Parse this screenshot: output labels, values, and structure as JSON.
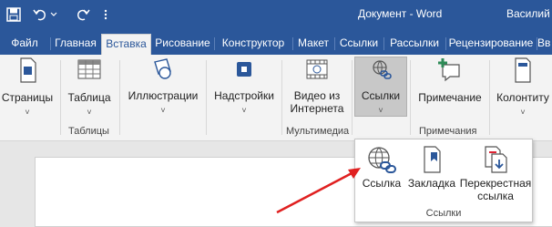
{
  "title_bar": {
    "document_title": "Документ - Word",
    "user_name": "Василий"
  },
  "quick_access": {
    "items": [
      "save-icon",
      "undo-icon",
      "undo-dropdown-icon",
      "redo-icon",
      "customize-icon"
    ]
  },
  "tabs": [
    {
      "label": "Файл"
    },
    {
      "label": "Главная"
    },
    {
      "label": "Вставка",
      "active": true
    },
    {
      "label": "Рисование"
    },
    {
      "label": "Конструктор"
    },
    {
      "label": "Макет"
    },
    {
      "label": "Ссылки"
    },
    {
      "label": "Рассылки"
    },
    {
      "label": "Рецензирование"
    },
    {
      "label": "Вв"
    }
  ],
  "ribbon": {
    "pages": {
      "label": "Страницы",
      "icon": "pages-icon"
    },
    "table": {
      "label": "Таблица",
      "icon": "table-icon",
      "group": "Таблицы"
    },
    "illustrations": {
      "label": "Иллюстрации",
      "icon": "illustrations-icon"
    },
    "addins": {
      "label": "Надстройки",
      "icon": "addins-icon"
    },
    "online_video": {
      "label_line1": "Видео из",
      "label_line2": "Интернета",
      "icon": "video-icon",
      "group": "Мультимедиа"
    },
    "links": {
      "label": "Ссылки",
      "icon": "links-icon",
      "pressed": true
    },
    "comment": {
      "label": "Примечание",
      "icon": "comment-icon",
      "group": "Примечания"
    },
    "header_footer": {
      "label": "Колонтиту",
      "icon": "header-footer-icon"
    },
    "chevron": "˅"
  },
  "links_dropdown": {
    "items": [
      {
        "label": "Ссылка",
        "icon": "hyperlink-icon"
      },
      {
        "label": "Закладка",
        "icon": "bookmark-icon"
      },
      {
        "label_line1": "Перекрестная",
        "label_line2": "ссылка",
        "icon": "cross-reference-icon"
      }
    ],
    "group_label": "Ссылки"
  },
  "colors": {
    "accent": "#2b579a",
    "arrow": "#e02020"
  }
}
